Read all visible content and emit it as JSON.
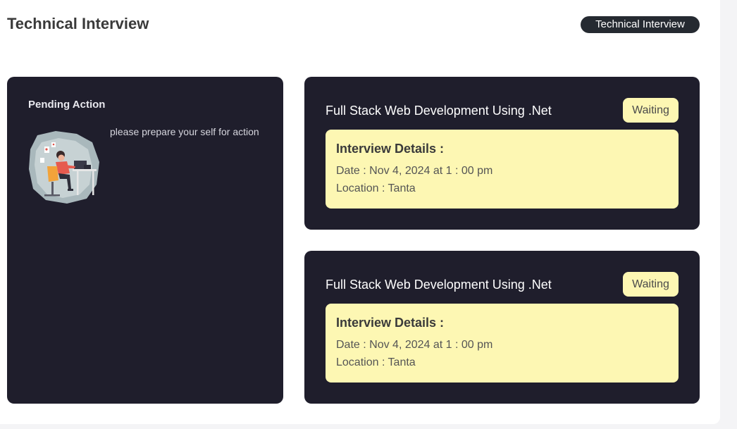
{
  "header": {
    "title": "Technical Interview",
    "badge": "Technical Interview"
  },
  "pending": {
    "title": "Pending Action",
    "message": "please prepare your self for action",
    "illustration": "person-at-desk-illustration"
  },
  "jobs": [
    {
      "title": "Full Stack Web Development Using .Net",
      "status": "Waiting",
      "details_heading": "Interview Details :",
      "date_label": "Date : ",
      "date": "Nov 4, 2024 at 1 : 00 pm",
      "location_label": "Location : ",
      "location": "Tanta"
    },
    {
      "title": "Full Stack Web Development Using .Net",
      "status": "Waiting",
      "details_heading": "Interview Details :",
      "date_label": "Date : ",
      "date": "Nov 4, 2024 at 1 : 00 pm",
      "location_label": "Location : ",
      "location": "Tanta"
    }
  ],
  "colors": {
    "card_bg": "#1f1e2c",
    "details_bg": "#fdf7b3",
    "badge_bg": "#252a31"
  }
}
